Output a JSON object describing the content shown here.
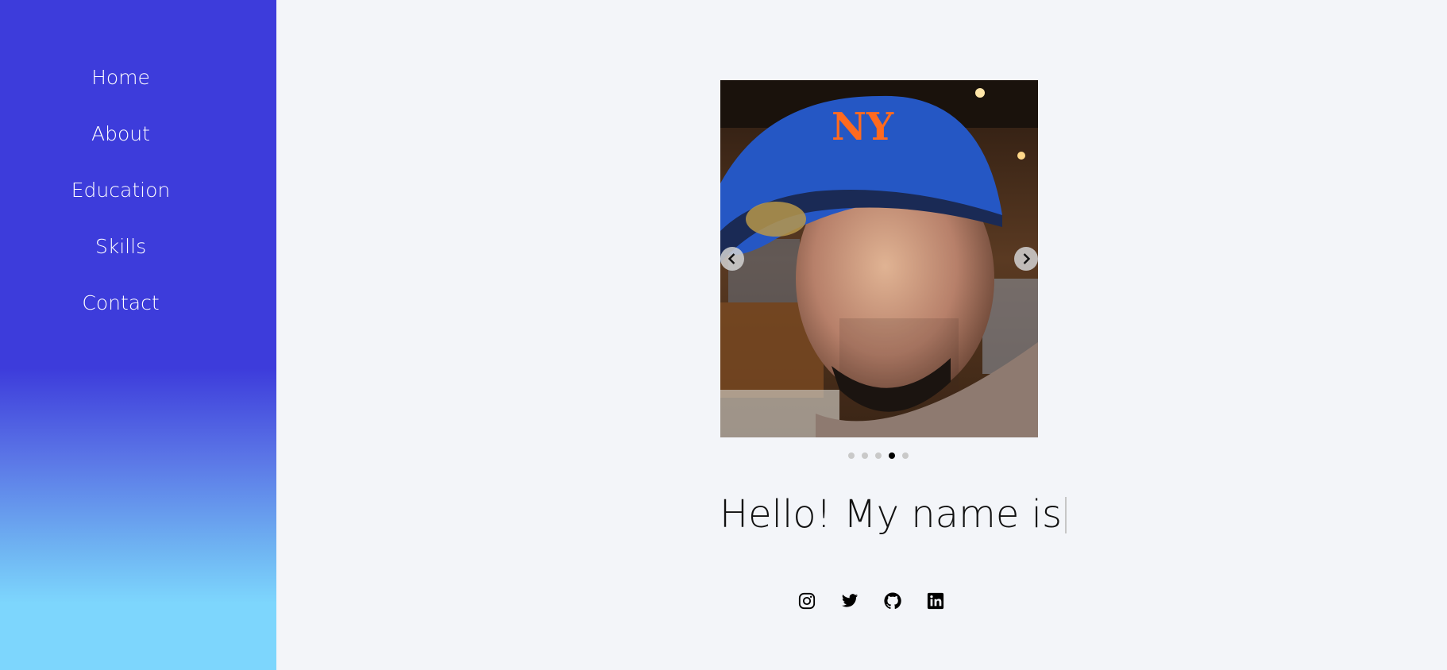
{
  "sidebar": {
    "items": [
      {
        "label": "Home"
      },
      {
        "label": "About"
      },
      {
        "label": "Education"
      },
      {
        "label": "Skills"
      },
      {
        "label": "Contact"
      }
    ],
    "gradient_top": "#3d3cdb",
    "gradient_bottom": "#7dd6fd"
  },
  "hero": {
    "carousel": {
      "slide_count": 5,
      "active_index": 3,
      "prev_icon": "chevron-left-icon",
      "next_icon": "chevron-right-icon"
    },
    "greeting": "Hello! My name is",
    "socials": [
      {
        "icon": "instagram-icon"
      },
      {
        "icon": "twitter-icon"
      },
      {
        "icon": "github-icon"
      },
      {
        "icon": "linkedin-icon"
      }
    ]
  }
}
